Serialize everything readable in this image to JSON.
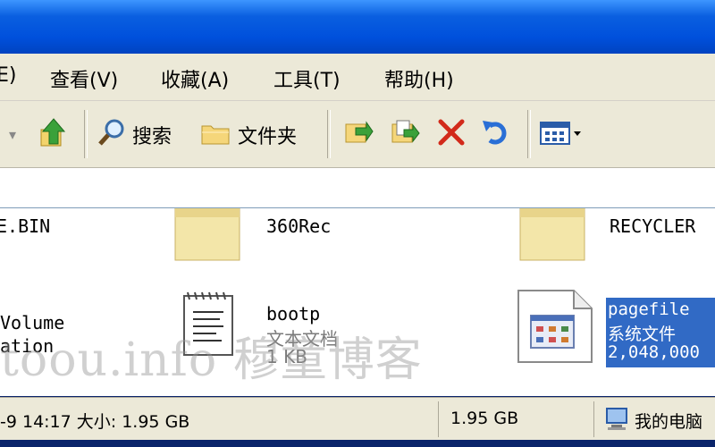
{
  "menu": {
    "items": [
      {
        "label": "E)"
      },
      {
        "label": "查看(V)"
      },
      {
        "label": "收藏(A)"
      },
      {
        "label": "工具(T)"
      },
      {
        "label": "帮助(H)"
      }
    ]
  },
  "toolbar": {
    "search_label": "搜索",
    "folders_label": "文件夹"
  },
  "files": [
    {
      "name": "E.BIN"
    },
    {
      "name": "360Rec"
    },
    {
      "name": "RECYCLER"
    },
    {
      "name": "Volume",
      "name2": "ation"
    },
    {
      "name": "bootp",
      "type": "文本文档",
      "size": "1 KB"
    },
    {
      "name": "pagefile",
      "type": "系统文件",
      "size": "2,048,000"
    }
  ],
  "watermark": "toou.info 穆童博客",
  "status": {
    "info": "-9 14:17 大小: 1.95 GB",
    "size": "1.95 GB",
    "location": "我的电脑"
  },
  "colors": {
    "selection": "#316ac5",
    "titlebar": "#0050dc",
    "chrome": "#ece9d8"
  }
}
